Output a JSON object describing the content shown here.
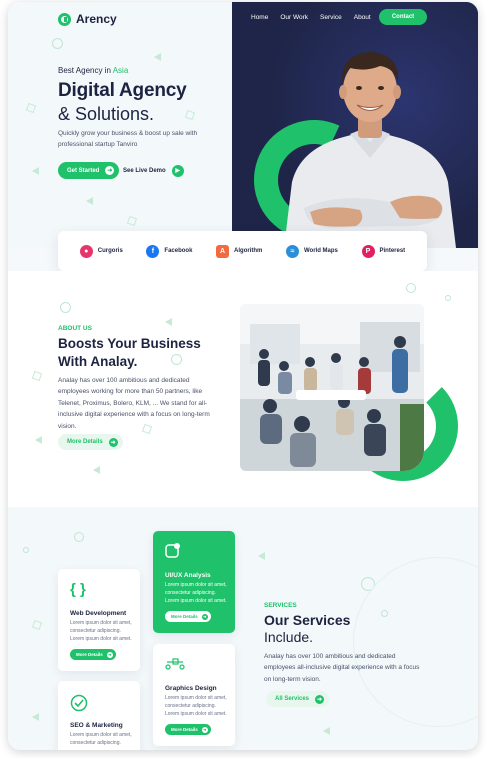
{
  "brand": {
    "name": "Arency"
  },
  "nav": {
    "items": [
      "Home",
      "Our Work",
      "Service",
      "About"
    ],
    "cta": "Contact"
  },
  "hero": {
    "subtitle_prefix": "Best Agency in",
    "subtitle_accent": "Asia",
    "title_line1": "Digital Agency",
    "title_line2": "& Solutions.",
    "description": "Quickly grow your business & boost up sale with professional startup Tanviro",
    "primary_btn": "Get Started",
    "secondary_btn": "See Live Demo"
  },
  "partners": [
    {
      "name": "Curgoris",
      "icon": "curgoris-icon",
      "color": "#e6356b"
    },
    {
      "name": "Facebook",
      "icon": "facebook-icon",
      "color": "#1877f2"
    },
    {
      "name": "Algorithm",
      "icon": "algorithm-icon",
      "color": "#f26a3d"
    },
    {
      "name": "World Maps",
      "icon": "world-maps-icon",
      "color": "#2b8fd8"
    },
    {
      "name": "Pinterest",
      "icon": "pinterest-icon",
      "color": "#e21f61"
    }
  ],
  "about": {
    "label": "ABOUT US",
    "title_line1": "Boosts Your Business",
    "title_line2": "With Analay.",
    "description": "Analay has over 100 ambitious and dedicated employees working for more than 50 partners, like Telenet, Proximus, Bolero, KLM, ... We stand for all-inclusive digital experience with a focus on long-term vision.",
    "button": "More Details"
  },
  "services": {
    "label": "SERVICES",
    "title_line1": "Our Services",
    "title_line2": "Include.",
    "description": "Analay has over 100 ambitious and dedicated employees all-inclusive digital experience with a focus on long-term vision.",
    "button": "All Services",
    "cards": [
      {
        "title": "Web Development",
        "desc": "Lorem ipsum dolor sit amet, consectetur adipiscing. Lorem ipsum dolor sit amet.",
        "button": "More Details",
        "icon": "code-braces-icon"
      },
      {
        "title": "UI/UX Analysis",
        "desc": "Lorem ipsum dolor sit amet, consectetur adipiscing. Lorem ipsum dolor sit amet.",
        "button": "More Details",
        "icon": "ui-ux-icon"
      },
      {
        "title": "Graphics Design",
        "desc": "Lorem ipsum dolor sit amet, consectetur adipiscing. Lorem ipsum dolor sit amet.",
        "button": "More Details",
        "icon": "vector-pen-icon"
      },
      {
        "title": "SEO & Marketing",
        "desc": "Lorem ipsum dolor sit amet, consectetur adipiscing.",
        "button": "More Details",
        "icon": "check-circle-icon"
      }
    ]
  },
  "colors": {
    "accent": "#1fc16b",
    "navy": "#1f2548",
    "text": "#1d2340"
  }
}
